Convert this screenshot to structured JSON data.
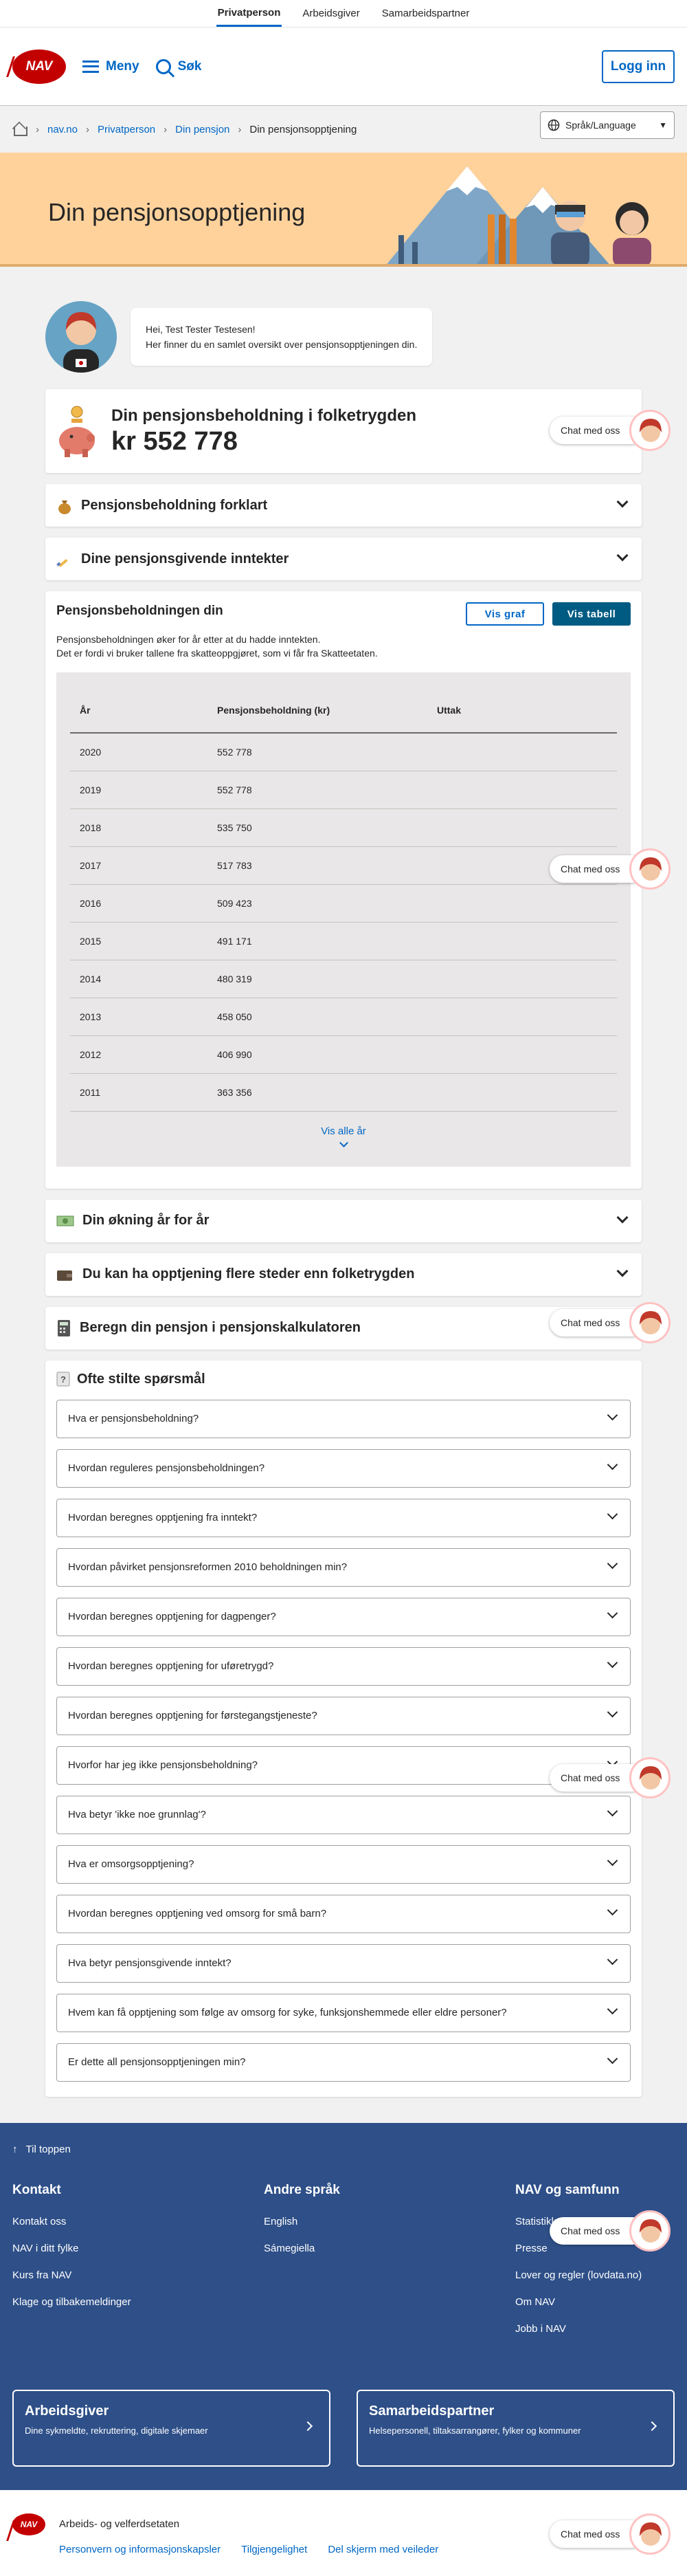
{
  "topnav": {
    "items": [
      "Privatperson",
      "Arbeidsgiver",
      "Samarbeidspartner"
    ]
  },
  "header": {
    "logo_text": "NAV",
    "menu_label": "Meny",
    "search_label": "Søk",
    "login_label": "Logg inn"
  },
  "breadcrumbs": {
    "items": [
      "nav.no",
      "Privatperson",
      "Din pensjon",
      "Din pensjonsopptjening"
    ]
  },
  "language": {
    "label": "Språk/Language"
  },
  "banner": {
    "title": "Din pensjonsopptjening"
  },
  "greeting": {
    "line1": "Hei, Test Tester Testesen!",
    "line2": "Her finner du en samlet oversikt over pensjonsopptjeningen din."
  },
  "balance": {
    "title": "Din pensjonsbeholdning i folketrygden",
    "amount": "kr 552 778"
  },
  "sections": {
    "explained": "Pensjonsbeholdning forklart",
    "income": "Dine pensjonsgivende inntekter",
    "increase": "Din økning år for år",
    "elsewhere": "Du kan ha opptjening flere steder enn folketrygden",
    "calculator": "Beregn din pensjon i pensjonskalkulatoren"
  },
  "holdings": {
    "title": "Pensjonsbeholdningen din",
    "text1": "Pensjonsbeholdningen øker for år etter at du hadde inntekten.",
    "text2": "Det er fordi vi bruker tallene fra skatteoppgjøret, som vi får fra Skatteetaten.",
    "btn_graph": "Vis graf",
    "btn_table": "Vis tabell",
    "columns": [
      "År",
      "Pensjonsbeholdning (kr)",
      "Uttak"
    ],
    "rows": [
      [
        "2020",
        "552 778",
        ""
      ],
      [
        "2019",
        "552 778",
        ""
      ],
      [
        "2018",
        "535 750",
        ""
      ],
      [
        "2017",
        "517 783",
        ""
      ],
      [
        "2016",
        "509 423",
        ""
      ],
      [
        "2015",
        "491 171",
        ""
      ],
      [
        "2014",
        "480 319",
        ""
      ],
      [
        "2013",
        "458 050",
        ""
      ],
      [
        "2012",
        "406 990",
        ""
      ],
      [
        "2011",
        "363 356",
        ""
      ]
    ],
    "show_all": "Vis alle år"
  },
  "faq": {
    "title": "Ofte stilte spørsmål",
    "questions": [
      "Hva er pensjonsbeholdning?",
      "Hvordan reguleres pensjonsbeholdningen?",
      "Hvordan beregnes opptjening fra inntekt?",
      "Hvordan påvirket pensjonsreformen 2010 beholdningen min?",
      "Hvordan beregnes opptjening for dagpenger?",
      "Hvordan beregnes opptjening for uføretrygd?",
      "Hvordan beregnes opptjening for førstegangstjeneste?",
      "Hvorfor har jeg ikke pensjonsbeholdning?",
      "Hva betyr 'ikke noe grunnlag'?",
      "Hva er omsorgsopptjening?",
      "Hvordan beregnes opptjening ved omsorg for små barn?",
      "Hva betyr pensjonsgivende inntekt?",
      "Hvem kan få opptjening som følge av omsorg for syke, funksjonshemmede eller eldre personer?",
      "Er dette all pensjonsopptjeningen min?"
    ]
  },
  "chat": {
    "label": "Chat med oss"
  },
  "footer": {
    "to_top": "Til toppen",
    "contact": {
      "title": "Kontakt",
      "links": [
        "Kontakt oss",
        "NAV i ditt fylke",
        "Kurs fra NAV",
        "Klage og tilbakemeldinger"
      ]
    },
    "languages": {
      "title": "Andre språk",
      "links": [
        "English",
        "Sámegiella"
      ]
    },
    "society": {
      "title": "NAV og samfunn",
      "links": [
        "Statistikk, analyse og FoU",
        "Presse",
        "Lover og regler (lovdata.no)",
        "Om NAV",
        "Jobb i NAV"
      ]
    },
    "employer": {
      "title": "Arbeidsgiver",
      "text": "Dine sykmeldte, rekruttering, digitale skjemaer"
    },
    "partner": {
      "title": "Samarbeidspartner",
      "text": "Helsepersonell, tiltaksarrangører, fylker og kommuner"
    },
    "org": "Arbeids- og velferdsetaten",
    "bottom_links": [
      "Personvern og informasjonskapsler",
      "Tilgjengelighet",
      "Del skjerm med veileder"
    ]
  },
  "colors": {
    "brand_red": "#c30000",
    "link_blue": "#0067c5",
    "banner": "#ffd29c",
    "footer": "#2e4f88"
  }
}
